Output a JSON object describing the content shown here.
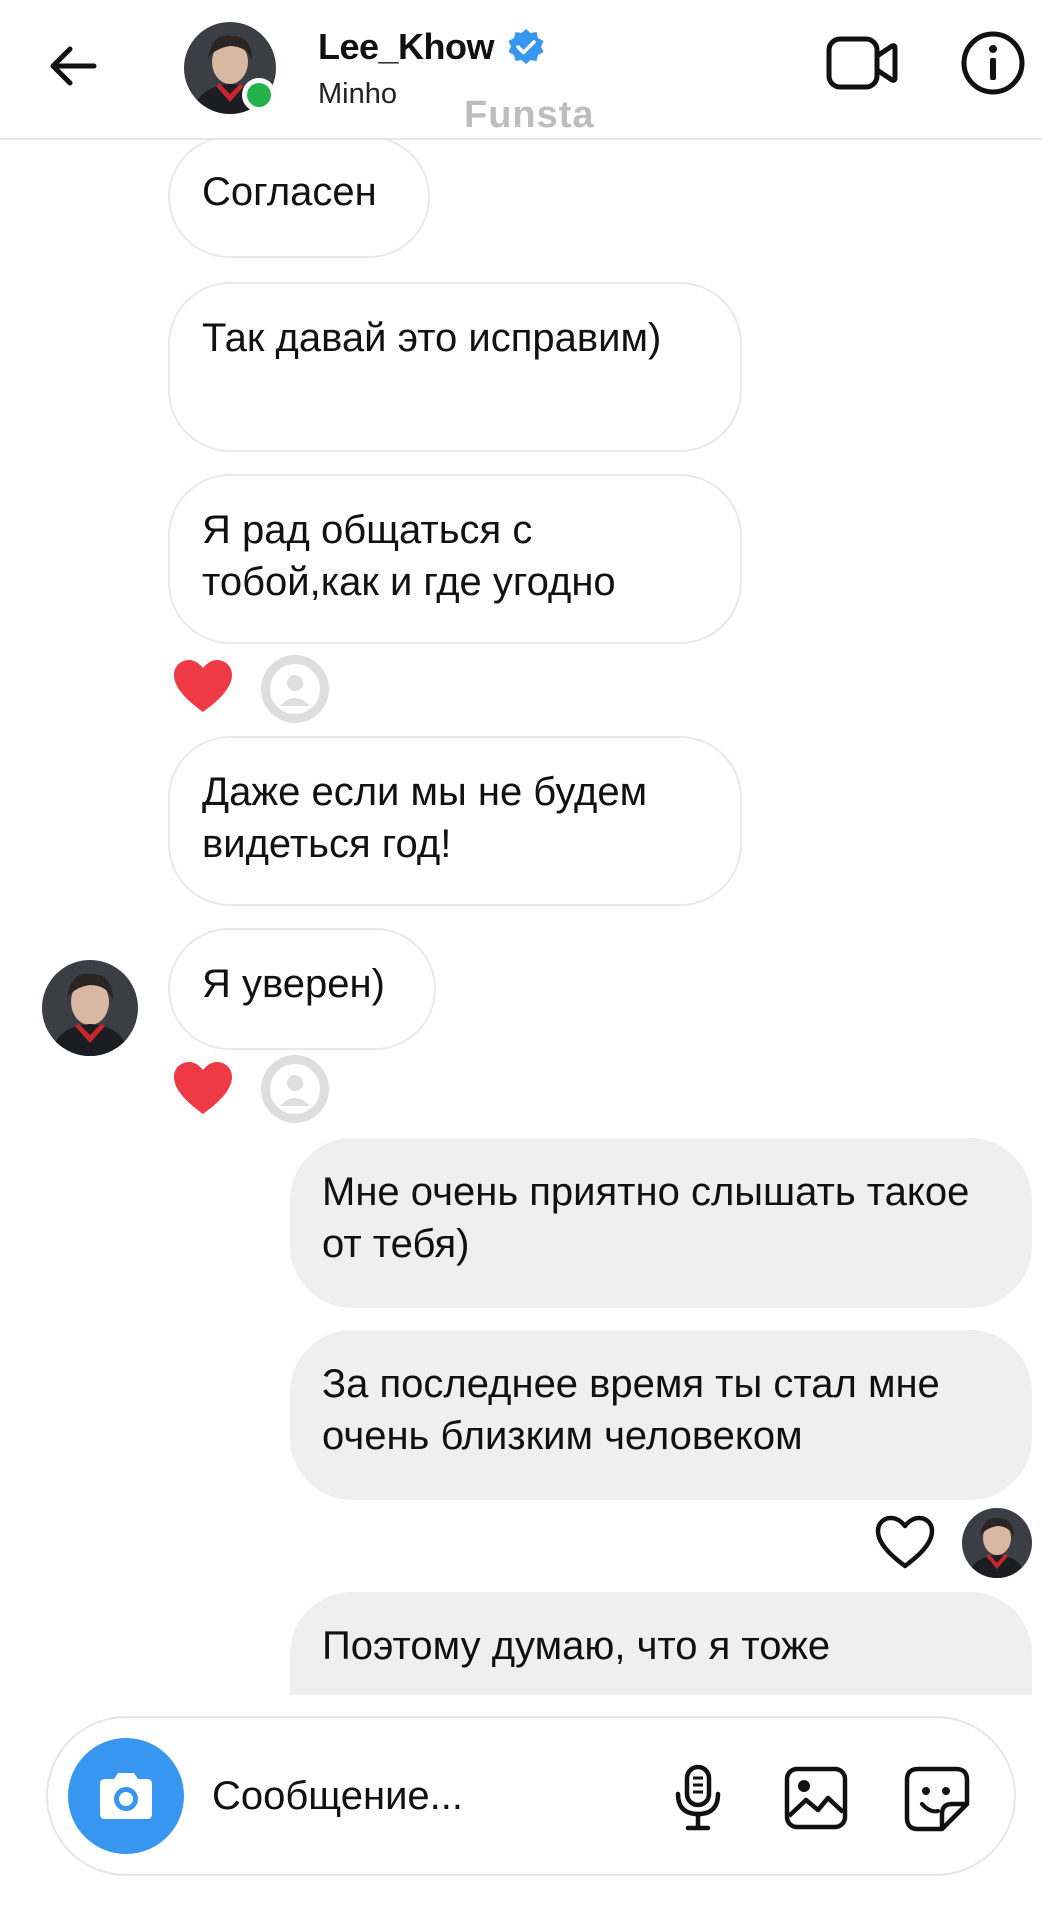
{
  "header": {
    "username": "Lee_Khow",
    "subtitle": "Minho",
    "watermark": "Funsta",
    "verified": true,
    "online": true
  },
  "messages": [
    {
      "direction": "in",
      "text": "Согласен"
    },
    {
      "direction": "in",
      "text": "Так давай это исправим)"
    },
    {
      "direction": "in",
      "text": "Я рад общаться с тобой,как и где угодно",
      "reaction": "red-heart"
    },
    {
      "direction": "in",
      "text": "Даже если мы не будем видеться год!"
    },
    {
      "direction": "in",
      "text": "Я уверен)",
      "reaction": "red-heart"
    },
    {
      "direction": "out",
      "text": "Мне очень приятно слышать такое от тебя)"
    },
    {
      "direction": "out",
      "text": "За последнее время ты стал мне очень близким человеком",
      "reaction": "outline-heart"
    },
    {
      "direction": "out",
      "text": "Поэтому думаю, что я тоже"
    }
  ],
  "composer": {
    "placeholder": "Сообщение..."
  },
  "colors": {
    "accent": "#3797f0",
    "online": "#23b34a",
    "heart": "#ef3a45",
    "incoming_border": "#e9e9e9",
    "outgoing_bg": "#efefef"
  }
}
